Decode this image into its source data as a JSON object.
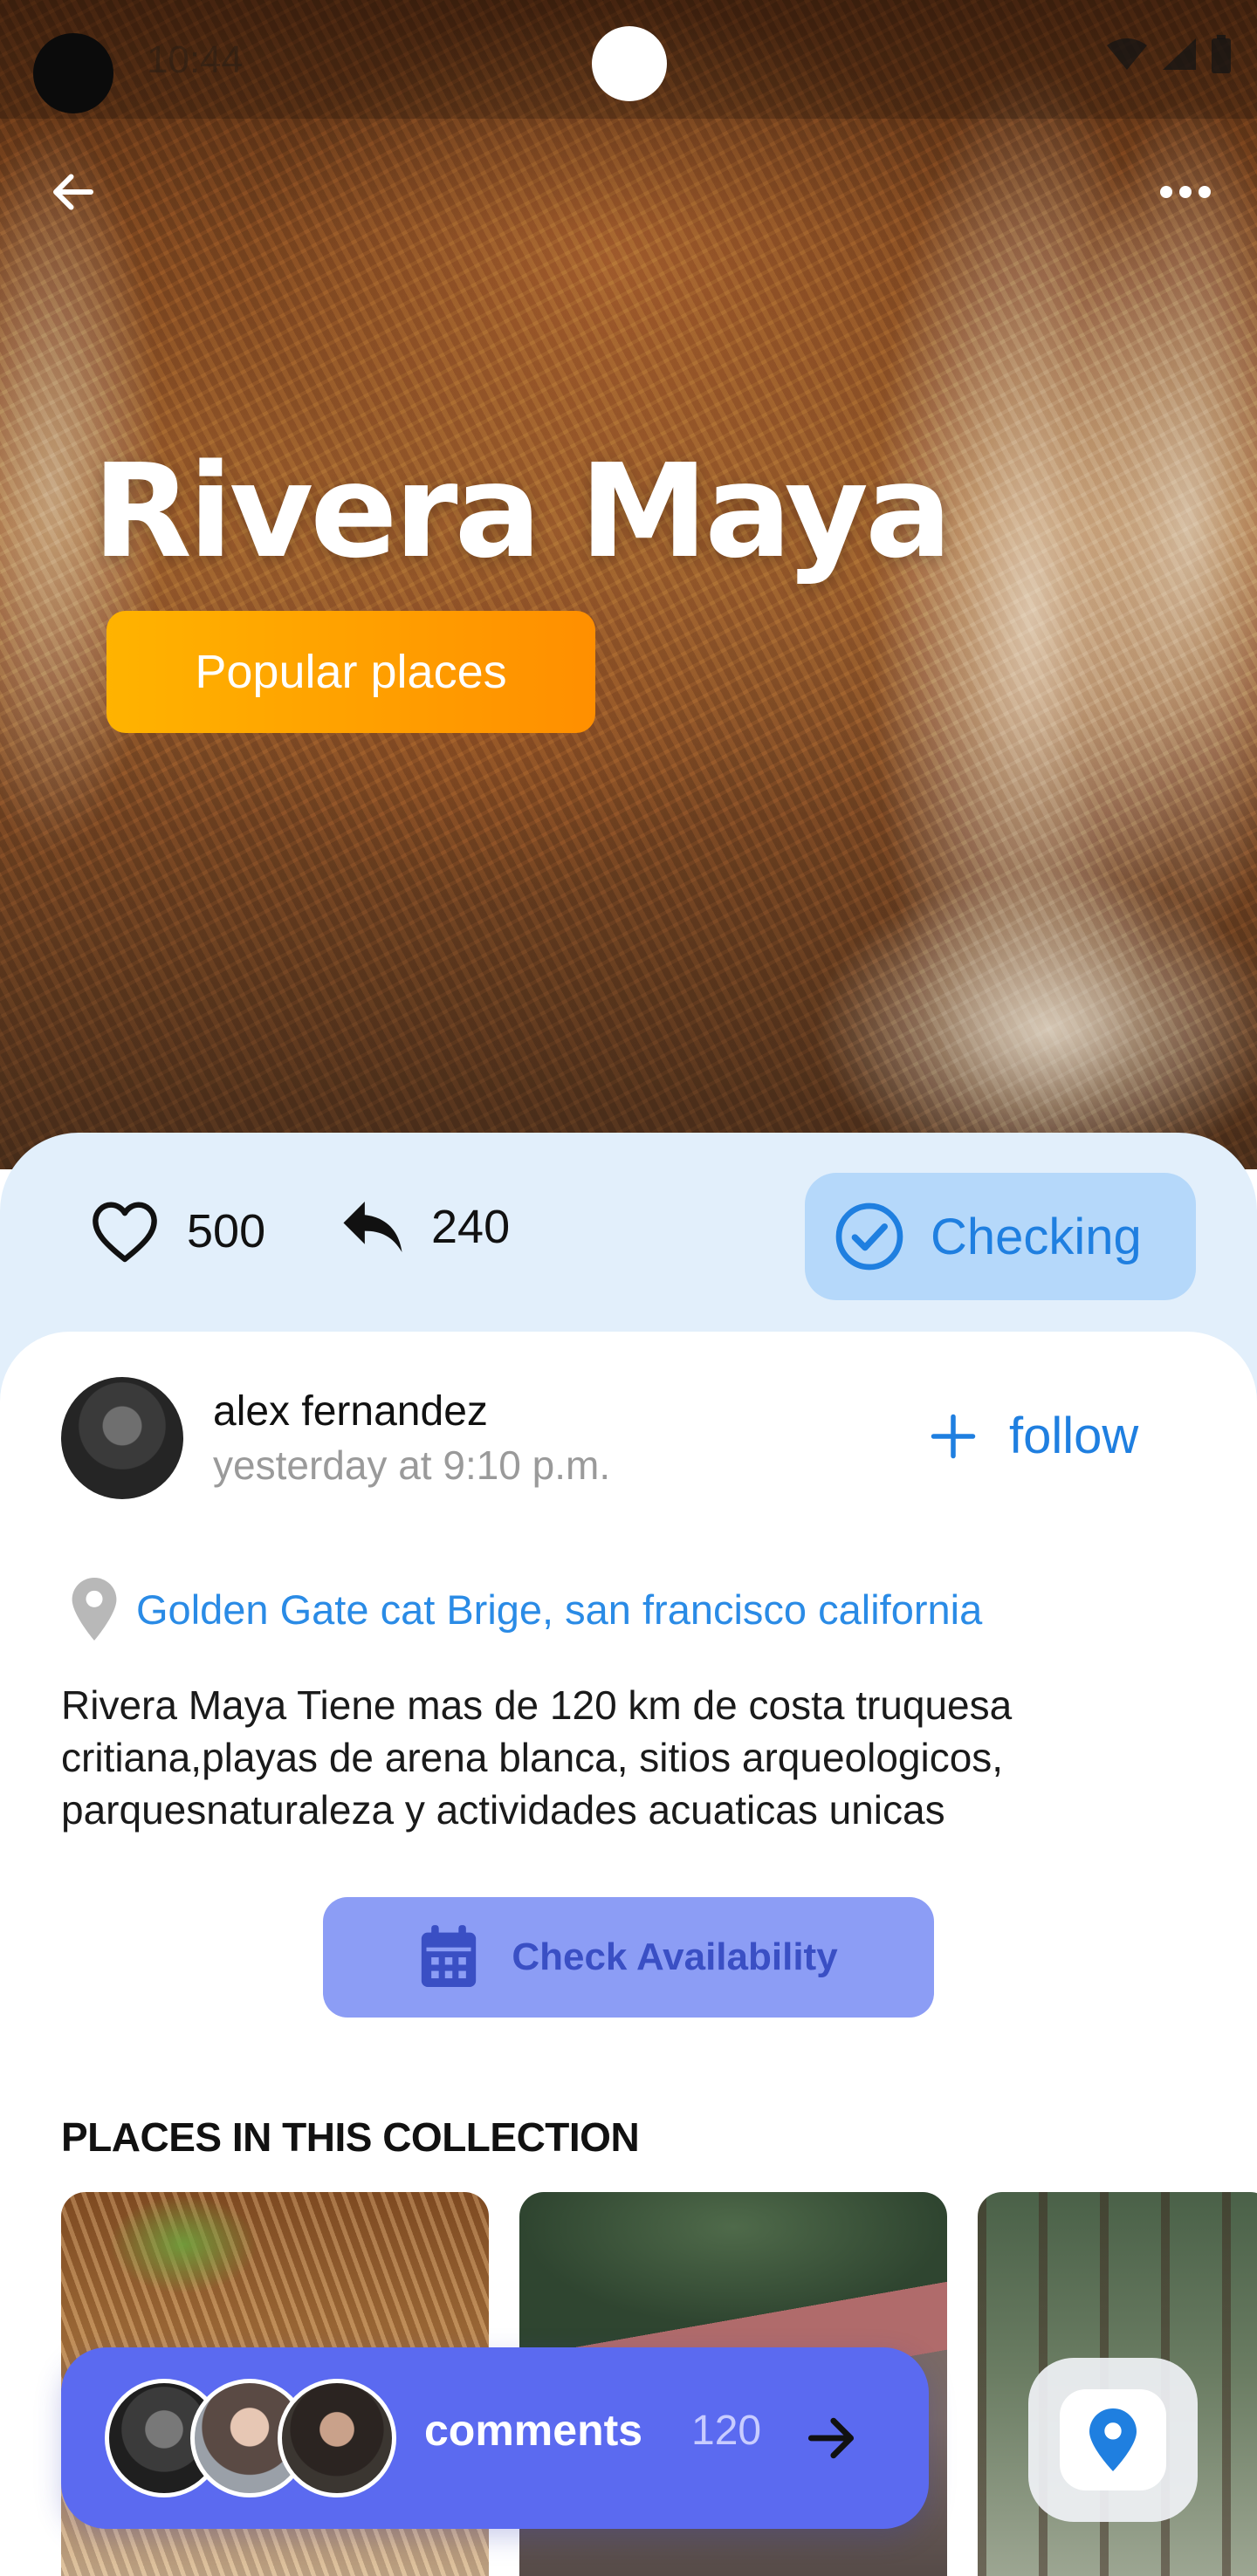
{
  "status_bar": {
    "time": "10:44"
  },
  "header": {
    "title": "Rivera Maya",
    "badge": "Popular places"
  },
  "stats": {
    "likes": "500",
    "shares": "240",
    "checking_label": "Checking"
  },
  "post": {
    "author": "alex fernandez",
    "time": "yesterday at 9:10 p.m.",
    "follow_label": "follow",
    "location": "Golden Gate cat Brige, san francisco california",
    "description": "Rivera Maya Tiene mas de 120 km de costa truquesa critiana,playas de arena blanca, sitios arqueologicos, parquesnaturaleza y actividades acuaticas unicas"
  },
  "availability": {
    "label": "Check Availability"
  },
  "collection": {
    "title": "PLACES IN THIS COLLECTION"
  },
  "comments": {
    "label": "comments",
    "count": "120"
  },
  "colors": {
    "accent_blue": "#1f7fe0",
    "badge_orange": "#ffb300",
    "comments_bar": "#5b6af0",
    "availability_button": "#8c9df5",
    "stats_background": "#e2effb"
  }
}
